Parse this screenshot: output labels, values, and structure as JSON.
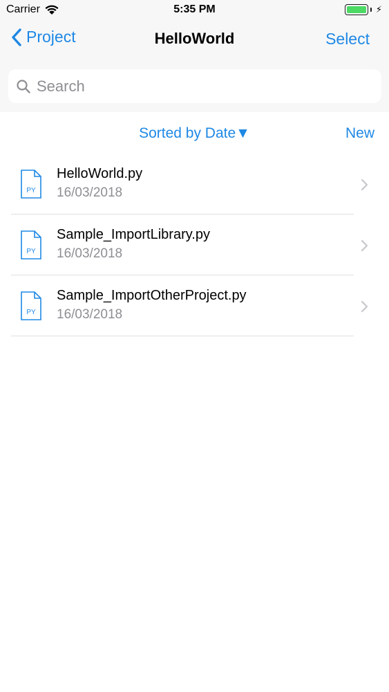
{
  "colors": {
    "accent": "#1e88e5",
    "battery_green": "#4cd964",
    "secondary_text": "#8e8e93",
    "chevron": "#c7c7cc",
    "nav_background": "#f7f7f7"
  },
  "status_bar": {
    "carrier": "Carrier",
    "time": "5:35 PM",
    "battery_level": 1.0
  },
  "nav": {
    "back_label": "Project",
    "title": "HelloWorld",
    "select_label": "Select"
  },
  "search": {
    "placeholder": "Search",
    "value": ""
  },
  "toolbar": {
    "sort_label": "Sorted by Date▼",
    "new_label": "New"
  },
  "files": [
    {
      "name": "HelloWorld.py",
      "date": "16/03/2018",
      "icon_label": "PY"
    },
    {
      "name": "Sample_ImportLibrary.py",
      "date": "16/03/2018",
      "icon_label": "PY"
    },
    {
      "name": "Sample_ImportOtherProject.py",
      "date": "16/03/2018",
      "icon_label": "PY"
    }
  ]
}
